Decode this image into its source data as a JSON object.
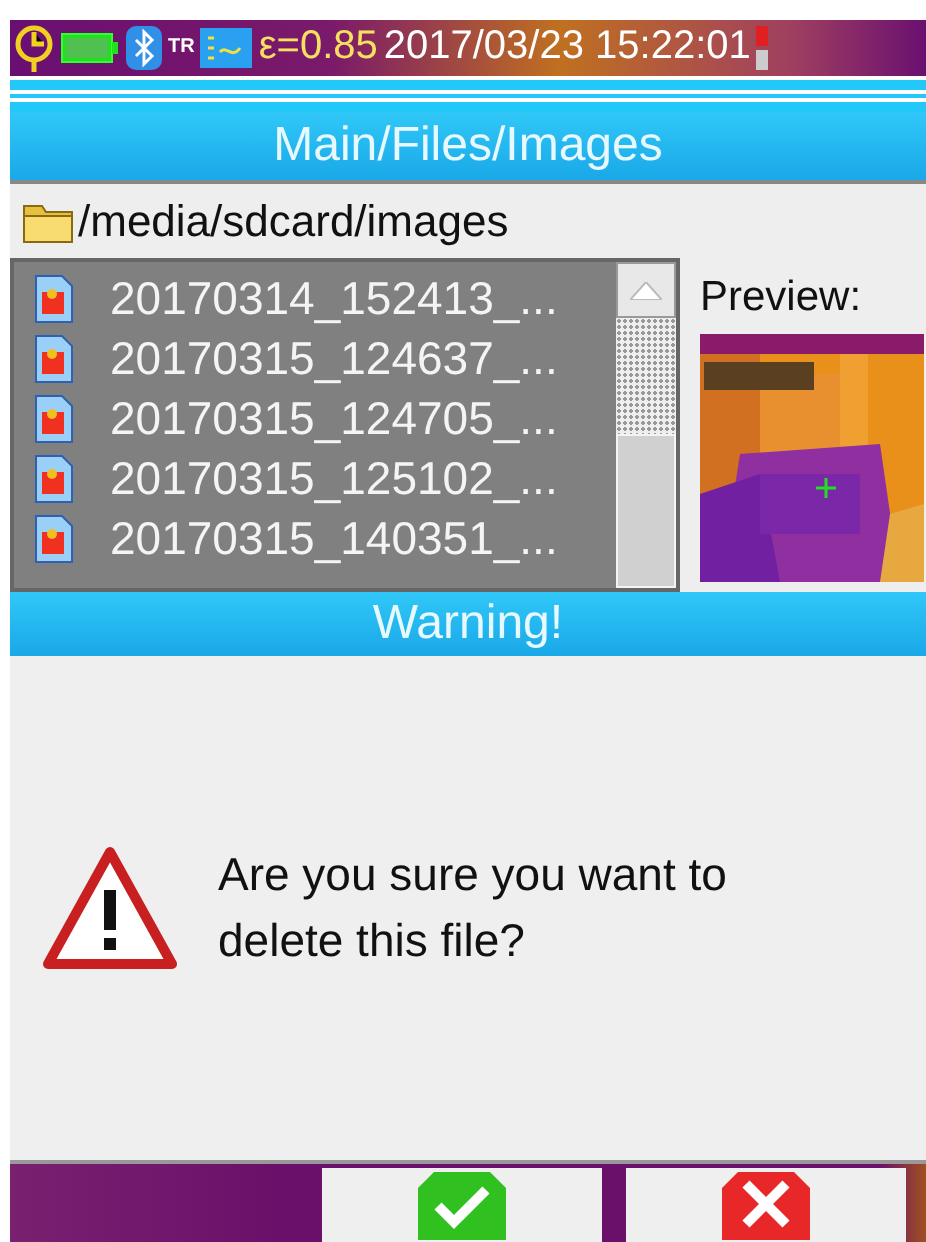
{
  "status_bar": {
    "mode": "TR",
    "emissivity": "ε=0.85",
    "datetime": "2017/03/23 15:22:01"
  },
  "title": "Main/Files/Images",
  "path": "/media/sdcard/images",
  "files": [
    {
      "name": "20170314_152413_..."
    },
    {
      "name": "20170315_124637_..."
    },
    {
      "name": "20170315_124705_..."
    },
    {
      "name": "20170315_125102_..."
    },
    {
      "name": "20170315_140351_..."
    }
  ],
  "preview": {
    "label": "Preview:",
    "kind": "picture"
  },
  "dialog": {
    "title": "Warning!",
    "message": "Are you sure you want to delete this file?"
  },
  "buttons": [
    {
      "kind": "confirm"
    },
    {
      "kind": "cancel"
    }
  ]
}
